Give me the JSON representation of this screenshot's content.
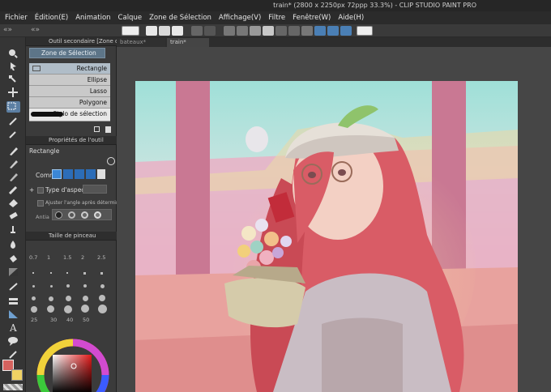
{
  "window": {
    "title": "train* (2800 x 2250px 72ppp 33.3%) - CLIP STUDIO PAINT PRO"
  },
  "menu": [
    "Fichier",
    "Édition(E)",
    "Animation",
    "Calque",
    "Zone de Sélection",
    "Affichage(V)",
    "Filtre",
    "Fenêtre(W)",
    "Aide(H)"
  ],
  "panels": {
    "sub_tool": {
      "title": "Outil secondaire [Zone de Sé",
      "group": "Zone de Sélection",
      "items": [
        "Rectangle",
        "Ellipse",
        "Lasso",
        "Polygone",
        "Stylo de sélection"
      ]
    },
    "tool_props": {
      "title": "Propriétés de l'outil",
      "tool_name": "Rectangle",
      "combine_label": "Comm",
      "aspect_label": "Type d'aspect",
      "angle_label": "Ajuster l'angle après détermination",
      "antialias_label": "Antia"
    },
    "brush_size": {
      "title": "Taille de pinceau",
      "sizes": [
        "0.7",
        "1",
        "1.5",
        "2",
        "2.5",
        "",
        "",
        "",
        "",
        "",
        "",
        "",
        "",
        "",
        "",
        "",
        "",
        "",
        "",
        "",
        "",
        "",
        "",
        "",
        "",
        "",
        "",
        "",
        "",
        "",
        "25",
        "30",
        "40",
        "50"
      ]
    }
  },
  "documents": {
    "tabs": [
      "bateaux*",
      "train*"
    ]
  },
  "colors": {
    "main": "#d4625e",
    "sub": "#f0d264",
    "accent": "#5c7fa3"
  }
}
